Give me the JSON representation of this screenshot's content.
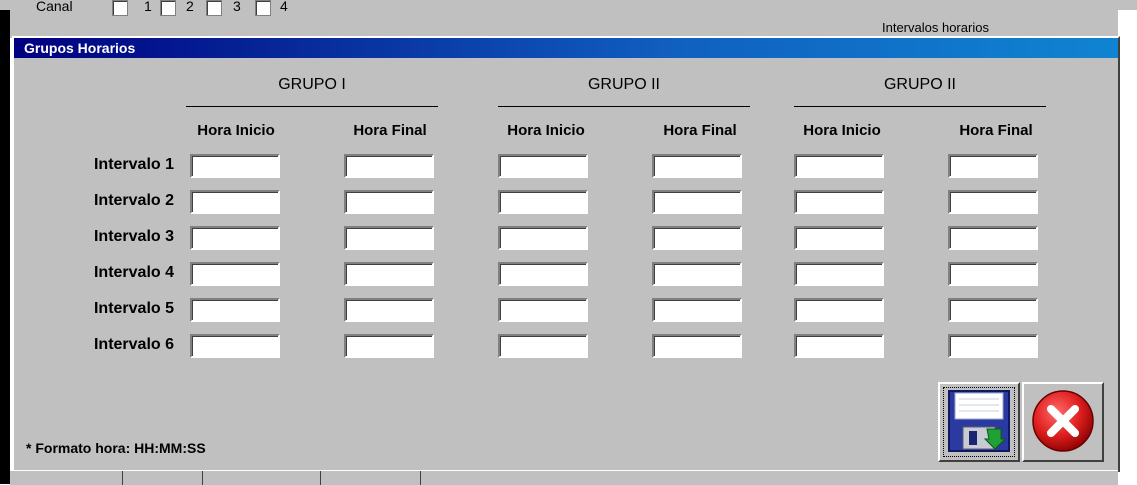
{
  "canal": {
    "label": "Canal",
    "options": [
      "1",
      "2",
      "3",
      "4"
    ]
  },
  "intervalos_caption": "Intervalos horarios",
  "window": {
    "title": "Grupos  Horarios"
  },
  "groups": [
    {
      "title": "GRUPO I",
      "start_label": "Hora Inicio",
      "end_label": "Hora Final"
    },
    {
      "title": "GRUPO II",
      "start_label": "Hora Inicio",
      "end_label": "Hora Final"
    },
    {
      "title": "GRUPO II",
      "start_label": "Hora Inicio",
      "end_label": "Hora Final"
    }
  ],
  "rows": [
    {
      "label": "Intervalo 1",
      "values": [
        "",
        "",
        "",
        "",
        "",
        ""
      ]
    },
    {
      "label": "Intervalo 2",
      "values": [
        "",
        "",
        "",
        "",
        "",
        ""
      ]
    },
    {
      "label": "Intervalo 3",
      "values": [
        "",
        "",
        "",
        "",
        "",
        ""
      ]
    },
    {
      "label": "Intervalo 4",
      "values": [
        "",
        "",
        "",
        "",
        "",
        ""
      ]
    },
    {
      "label": "Intervalo 5",
      "values": [
        "",
        "",
        "",
        "",
        "",
        ""
      ]
    },
    {
      "label": "Intervalo 6",
      "values": [
        "",
        "",
        "",
        "",
        "",
        ""
      ]
    }
  ],
  "footnote": "* Formato hora: HH:MM:SS",
  "buttons": {
    "save_icon": "floppy-disk-icon",
    "cancel_icon": "red-x-icon"
  },
  "colors": {
    "face": "#c0c0c0",
    "title_start": "#000080",
    "title_end": "#1084d0",
    "cancel_red": "#e02020"
  }
}
